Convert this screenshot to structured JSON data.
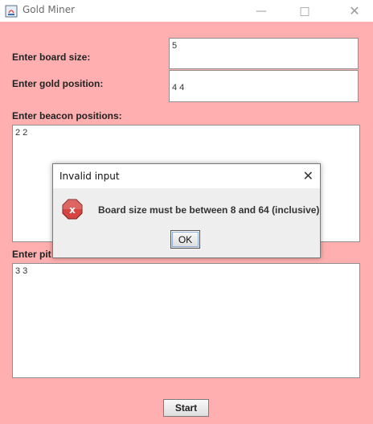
{
  "window": {
    "title": "Gold Miner",
    "minimize_icon": "minimize-icon",
    "maximize_icon": "maximize-icon",
    "close_icon": "close-icon"
  },
  "form": {
    "board_size_label": "Enter board size:",
    "board_size_value": "5",
    "gold_position_label": "Enter gold position:",
    "gold_position_value": "4 4",
    "beacon_positions_label": "Enter beacon positions:",
    "beacon_positions_value": "2 2",
    "pit_positions_label": "Enter pit",
    "pit_positions_value": "3 3",
    "start_label": "Start"
  },
  "dialog": {
    "title": "Invalid input",
    "message": "Board size must be between 8 and 64 (inclusive)",
    "ok_label": "OK",
    "icon": "error-icon"
  },
  "colors": {
    "background": "#ffafaf",
    "error_icon": "#c0392b"
  }
}
